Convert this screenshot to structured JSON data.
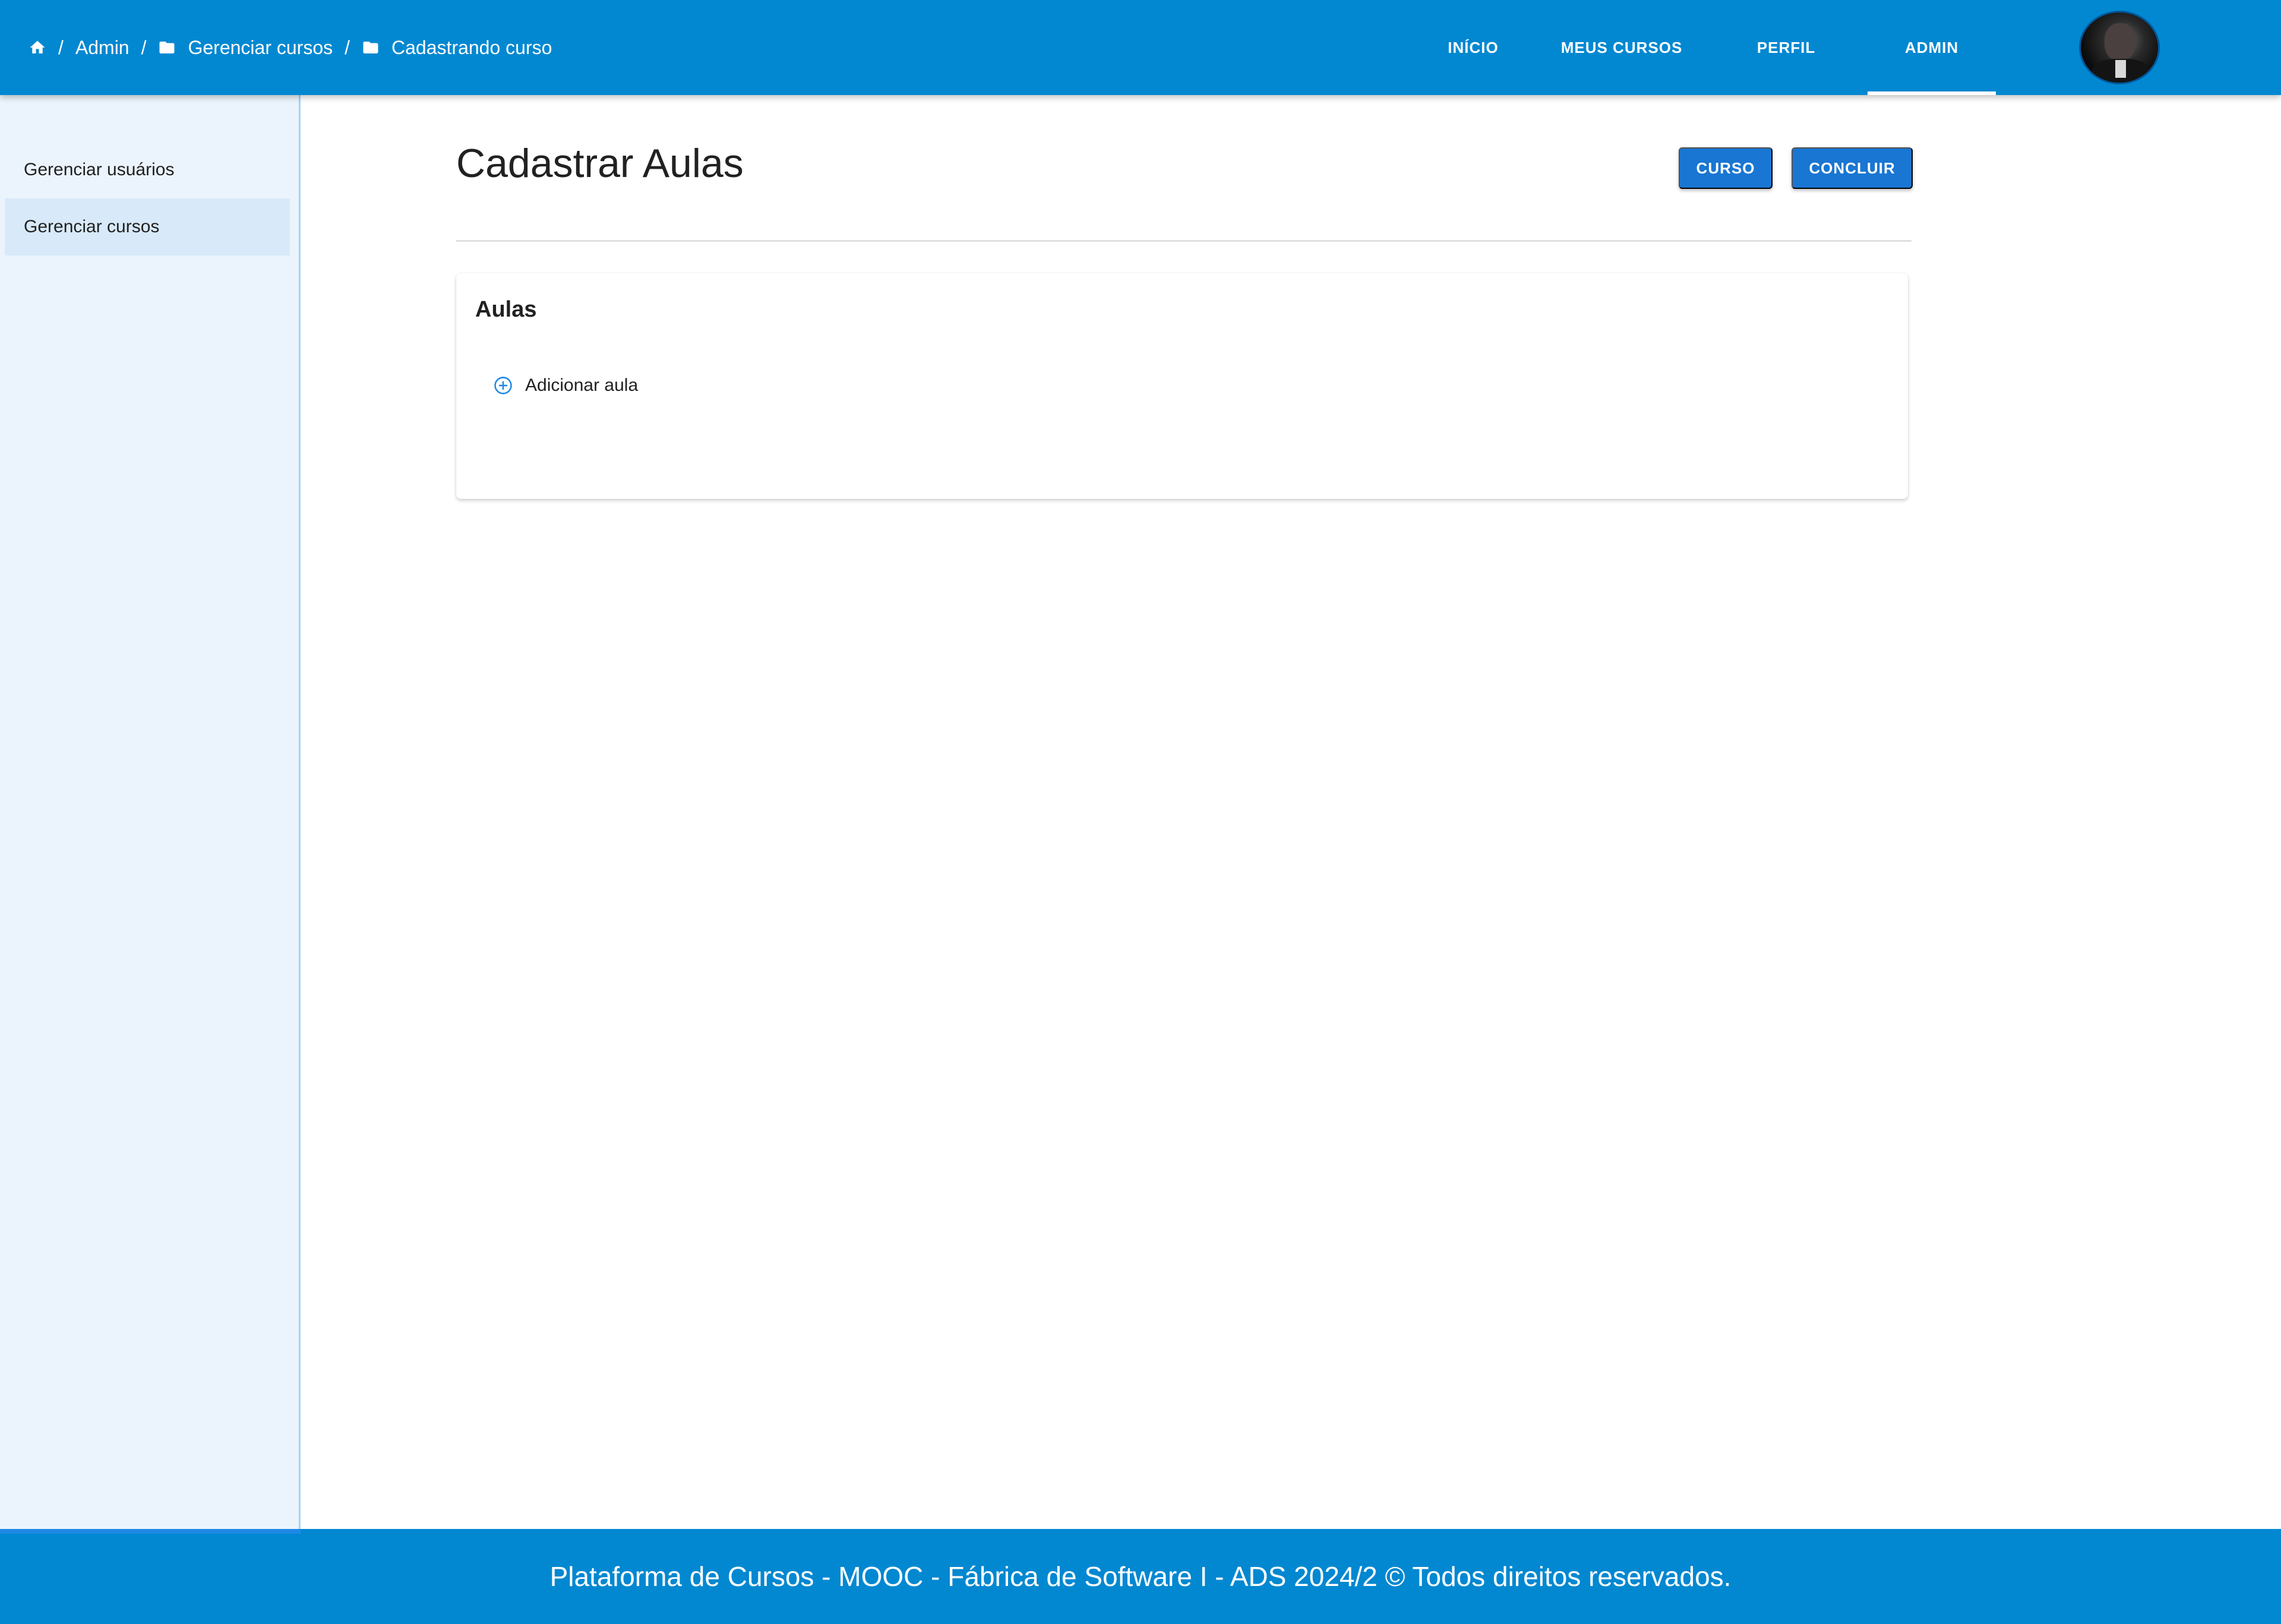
{
  "breadcrumb": {
    "home_icon": "home-icon",
    "items": [
      {
        "label": "Admin",
        "icon": ""
      },
      {
        "label": "Gerenciar cursos",
        "icon": "folder-icon"
      },
      {
        "label": "Cadastrando curso",
        "icon": "folder-icon"
      }
    ]
  },
  "nav": {
    "tabs": [
      {
        "label": "INÍCIO",
        "active": false
      },
      {
        "label": "MEUS CURSOS",
        "active": false
      },
      {
        "label": "PERFIL",
        "active": false
      },
      {
        "label": "ADMIN",
        "active": true
      }
    ]
  },
  "sidebar": {
    "items": [
      {
        "label": "Gerenciar usuários",
        "active": false
      },
      {
        "label": "Gerenciar cursos",
        "active": true
      }
    ]
  },
  "main": {
    "title": "Cadastrar Aulas",
    "buttons": {
      "curso": "CURSO",
      "concluir": "CONCLUIR"
    },
    "card": {
      "title": "Aulas",
      "add_label": "Adicionar aula",
      "add_icon": "plus-circle-icon"
    }
  },
  "footer": {
    "text": "Plataforma de Cursos - MOOC - Fábrica de Software I - ADS 2024/2  ©  Todos direitos reservados."
  },
  "colors": {
    "appbar": "#0288d1",
    "button": "#1976d2",
    "sidebar_bg": "#ebf4fc",
    "sidebar_active": "#d8eaf9"
  }
}
